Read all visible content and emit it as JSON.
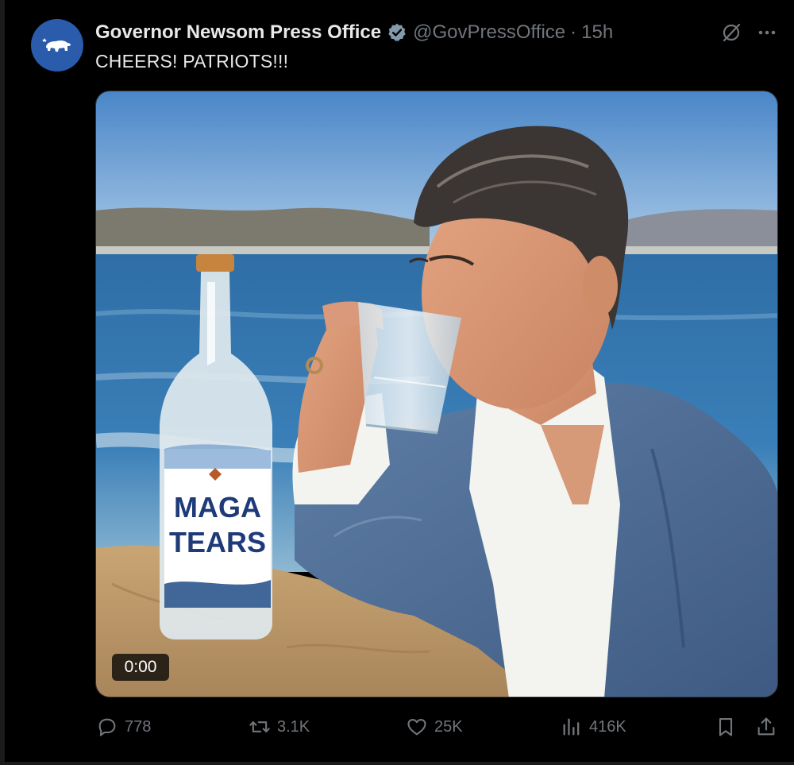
{
  "tweet": {
    "author_name": "Governor Newsom Press Office",
    "handle": "@GovPressOffice",
    "separator": "·",
    "time": "15h",
    "text": "CHEERS! PATRIOTS!!!"
  },
  "media": {
    "bottle_label_line1": "MAGA",
    "bottle_label_line2": "TEARS",
    "video_timestamp": "0:00"
  },
  "actions": {
    "replies": "778",
    "reposts": "3.1K",
    "likes": "25K",
    "views": "416K"
  },
  "colors": {
    "background": "#000000",
    "text_primary": "#e7e9ea",
    "text_secondary": "#71767b",
    "verified_badge": "#829aab",
    "avatar_bg": "#2a5cab"
  },
  "icons": {
    "top_right": [
      "grok-icon",
      "more-icon"
    ],
    "actions": [
      "reply-icon",
      "repost-icon",
      "like-icon",
      "views-icon",
      "bookmark-icon",
      "share-icon"
    ]
  }
}
